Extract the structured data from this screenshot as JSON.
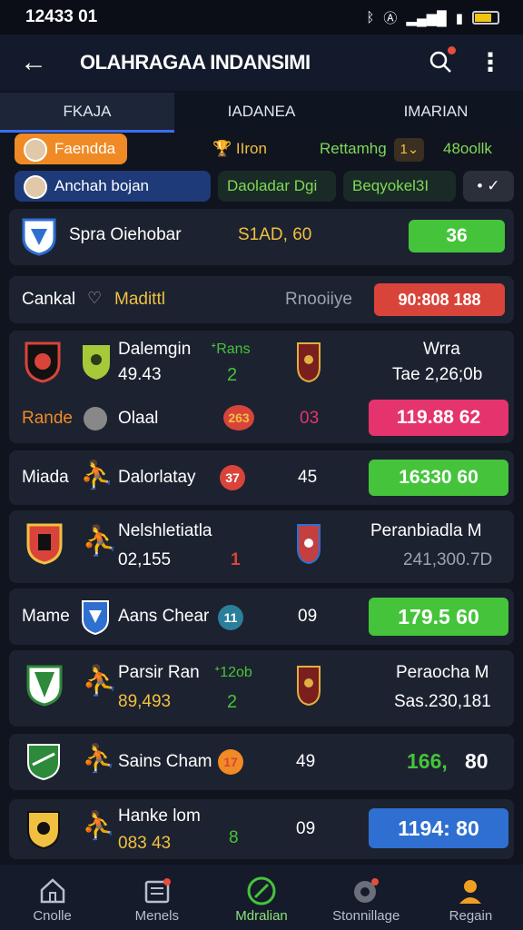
{
  "status": {
    "time": "12433 01"
  },
  "appbar": {
    "title": "OLAHRAGAA INDANSIMI"
  },
  "tabs": [
    "FKAJA",
    "IADANEA",
    "IMARIAN"
  ],
  "chips": {
    "c1": "Faendda",
    "c2": "IIron",
    "c3": "Rettamhg",
    "c3b": "1⌄",
    "c4": "48oollk",
    "c5": "Anchah bojan",
    "c6": "Daoladar Dgi",
    "c7": "Beqyokel3I",
    "c8": "• ✓"
  },
  "rows": {
    "r1": {
      "name": "Spra Oiehobar",
      "score": "S1AD, 60",
      "pill": "36"
    },
    "r2": {
      "left": "Cankal",
      "mid": "Madittl",
      "right": "Rnooiiye",
      "pill": "90:808 188"
    },
    "r3": {
      "name": "Dalemgin",
      "num": "49.43",
      "small": "ᐩRans",
      "score": "2",
      "rlabel": "Wrra",
      "rsub": "Tae 2,26;0b",
      "bleft": "Rande",
      "bname": "Olaal",
      "bcirc": "263",
      "bnum": "03",
      "pill": "119.88 62"
    },
    "r4": {
      "left": "Miada",
      "name": "Dalorlatay",
      "circ": "37",
      "num": "45",
      "pill": "16330 60"
    },
    "r5": {
      "name": "Nelshletiatla",
      "num": "02,155",
      "score": "1",
      "rlabel": "Peranbiadla M",
      "rsub": "241,300.7D"
    },
    "r6": {
      "left": "Mame",
      "name": "Aans Chear",
      "circ": "11",
      "num": "09",
      "pill": "179.5 60"
    },
    "r7": {
      "name": "Parsir Ran",
      "num": "89,493",
      "small": "ᐩ12ob",
      "score": "2",
      "rlabel": "Peraocha M",
      "rsub": "Sas.230,181"
    },
    "r8": {
      "name": "Sains Cham",
      "circ": "17",
      "num": "49",
      "pill_a": "166,",
      "pill_b": "80"
    },
    "r9": {
      "name": "Hanke lom",
      "num": "083 43",
      "score": "8",
      "mid": "09",
      "pill": "1194: 80"
    }
  },
  "bottom_nav": [
    "Cnolle",
    "Menels",
    "Mdralian",
    "Stonnillage",
    "Regain"
  ],
  "colors": {
    "green": "#45c43b",
    "red": "#d9443a",
    "pink": "#e5336e",
    "blue": "#2f6fd1",
    "orange": "#f08a24"
  }
}
